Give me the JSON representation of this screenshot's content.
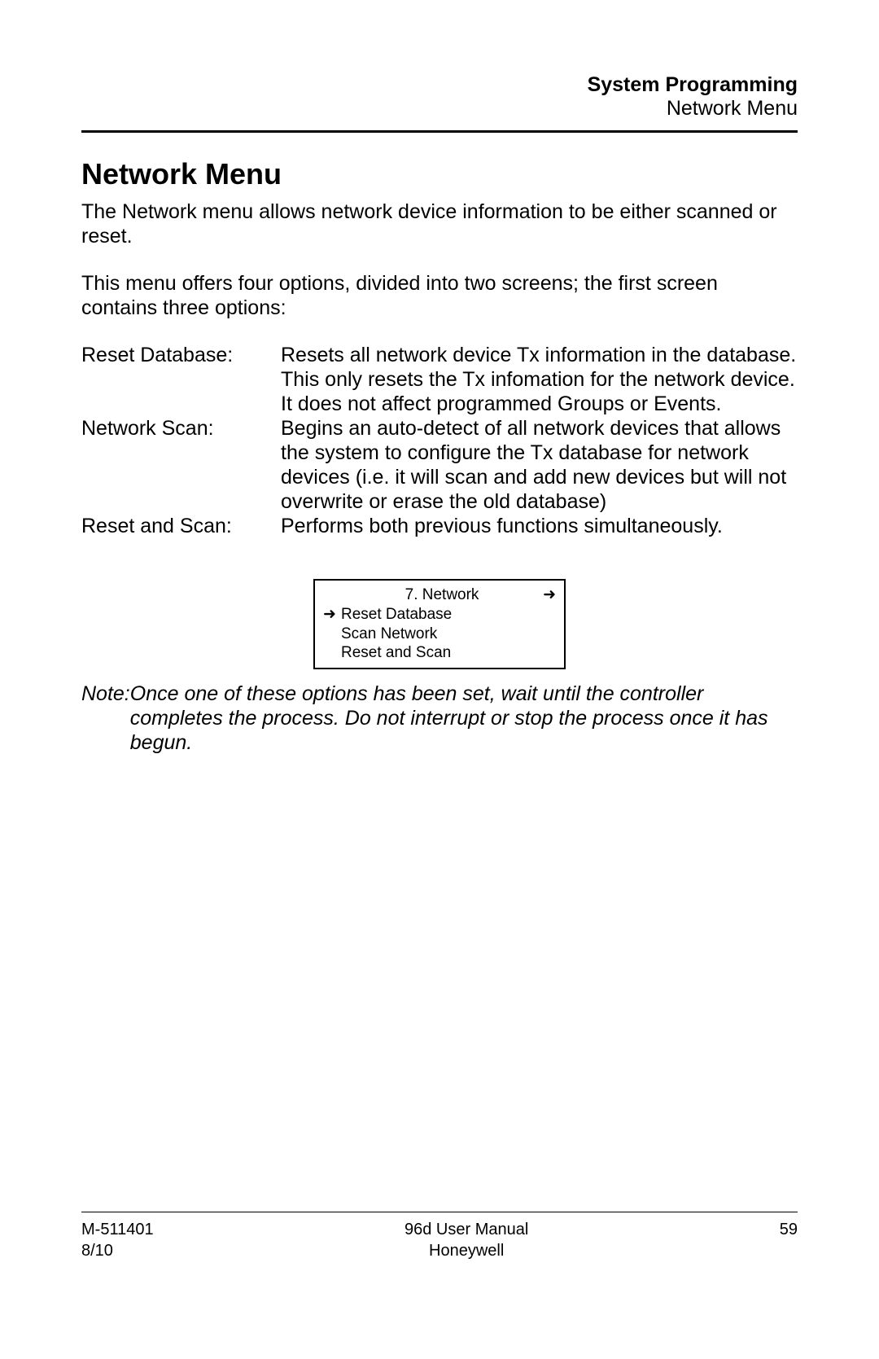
{
  "header": {
    "title": "System Programming",
    "subtitle": "Network Menu"
  },
  "section_title": "Network Menu",
  "para1": "The Network menu allows network device information to be either scanned or reset.",
  "para2": "This menu offers four options, divided into two screens; the first screen contains three options:",
  "options": [
    {
      "label": "Reset Database:",
      "desc": "Resets all network device Tx information in the database.  This only resets the Tx infomation for the network device.  It does not affect programmed Groups or Events."
    },
    {
      "label": "Network Scan:",
      "desc": "Begins an auto-detect of all network devices that allows the system to configure the Tx database for network devices (i.e. it will scan and add new devices but will not overwrite or erase the old database)"
    },
    {
      "label": "Reset and Scan:",
      "desc": "Performs both previous functions simultaneously."
    }
  ],
  "lcd": {
    "title": "7. Network",
    "items": [
      "Reset Database",
      "Scan Network",
      "Reset and Scan"
    ]
  },
  "note": {
    "label": "Note: ",
    "text": "Once one of these options has been set, wait until the controller completes the process. Do not interrupt or stop the process once it has begun."
  },
  "footer": {
    "left1": "M-511401",
    "left2": "8/10",
    "center1": "96d User Manual",
    "center2": "Honeywell",
    "right": "59"
  }
}
